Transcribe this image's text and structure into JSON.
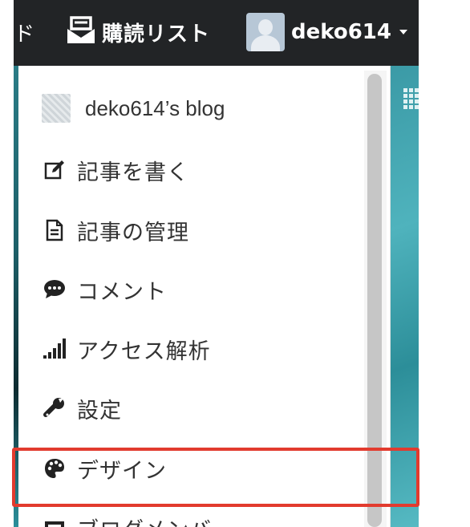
{
  "topbar": {
    "partial_label": "ド",
    "reading_list_label": "購読リスト",
    "username": "deko614"
  },
  "dropdown": {
    "blog_name": "deko614’s blog",
    "items": [
      {
        "label": "記事を書く",
        "icon": "edit-icon"
      },
      {
        "label": "記事の管理",
        "icon": "document-icon"
      },
      {
        "label": "コメント",
        "icon": "comment-icon"
      },
      {
        "label": "アクセス解析",
        "icon": "signal-bars-icon"
      },
      {
        "label": "設定",
        "icon": "wrench-icon"
      },
      {
        "label": "デザイン",
        "icon": "palette-icon"
      },
      {
        "label": "ブログメンバー",
        "icon": "members-icon"
      }
    ]
  },
  "colors": {
    "topbar": "#222426",
    "highlight": "#e23b2e",
    "accent_teal": "#4fb3bd"
  }
}
